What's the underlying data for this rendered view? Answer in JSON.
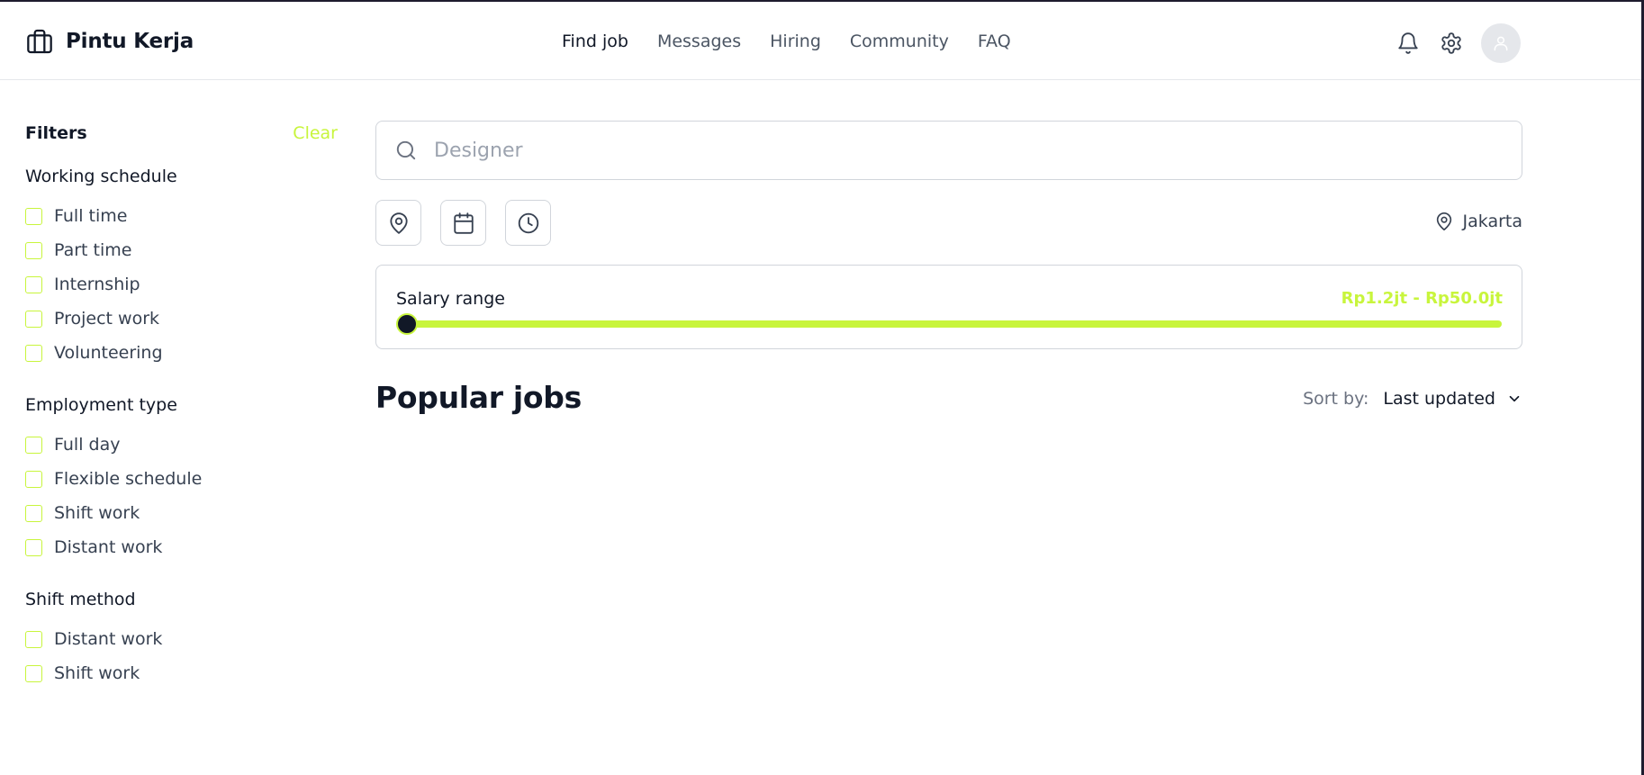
{
  "brand": {
    "name": "Pintu Kerja",
    "icon": "briefcase-icon"
  },
  "nav": [
    {
      "label": "Find job",
      "active": true
    },
    {
      "label": "Messages",
      "active": false
    },
    {
      "label": "Hiring",
      "active": false
    },
    {
      "label": "Community",
      "active": false
    },
    {
      "label": "FAQ",
      "active": false
    }
  ],
  "header_icons": [
    "bell-icon",
    "gear-icon",
    "user-icon"
  ],
  "filters": {
    "title": "Filters",
    "clear_label": "Clear",
    "groups": [
      {
        "title": "Working schedule",
        "options": [
          "Full time",
          "Part time",
          "Internship",
          "Project work",
          "Volunteering"
        ]
      },
      {
        "title": "Employment type",
        "options": [
          "Full day",
          "Flexible schedule",
          "Shift work",
          "Distant work"
        ]
      },
      {
        "title": "Shift method",
        "options": [
          "Distant work",
          "Shift work"
        ]
      }
    ]
  },
  "search": {
    "placeholder": "Designer",
    "value": ""
  },
  "quick_filters": [
    "map-pin-icon",
    "calendar-icon",
    "clock-icon"
  ],
  "location": {
    "label": "Jakarta"
  },
  "salary": {
    "label": "Salary range",
    "range_text": "Rp1.2jt - Rp50.0jt",
    "min_fraction": 0.0
  },
  "popular": {
    "title": "Popular jobs"
  },
  "sort": {
    "label": "Sort by:",
    "value": "Last updated"
  },
  "colors": {
    "accent": "#c8f53c",
    "text": "#111827",
    "muted": "#6b7280",
    "border": "#d1d5db"
  }
}
